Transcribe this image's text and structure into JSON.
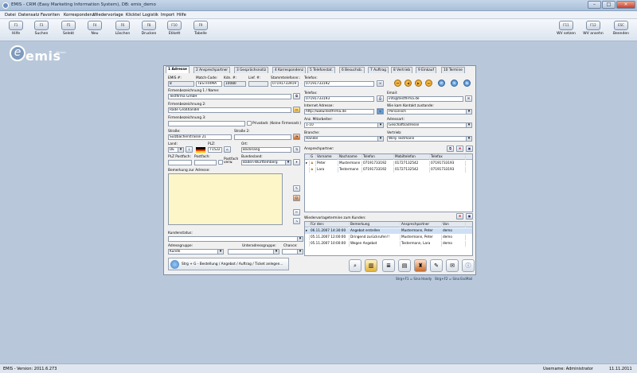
{
  "window": {
    "title": "EMIS - CRM (Easy Marketing Information System), DB: emis_demo",
    "controls": [
      "–",
      "□",
      "×"
    ]
  },
  "menu": [
    "Datei",
    "Datensatz",
    "Favoriten",
    "Korrespondenz",
    "Wiedervorlage",
    "Klicktel",
    "Logistik",
    "Import",
    "Hilfe"
  ],
  "toolbar": {
    "left": [
      {
        "key": "F1",
        "label": "Hilfe"
      },
      {
        "key": "F3",
        "label": "Suchen"
      },
      {
        "key": "F5",
        "label": "Selekt"
      },
      {
        "key": "F4",
        "label": "Neu"
      },
      {
        "key": "F6",
        "label": "Löschen"
      },
      {
        "key": "F8",
        "label": "Drucken"
      },
      {
        "key": "F10",
        "label": "Etikett"
      },
      {
        "key": "F9",
        "label": "Tabelle"
      }
    ],
    "right": [
      {
        "key": "F11",
        "label": "WV setzen"
      },
      {
        "key": "F12",
        "label": "WV ansehn"
      },
      {
        "key": "ESC",
        "label": "Beenden"
      }
    ]
  },
  "logo": {
    "text": "emis",
    "small": "Version"
  },
  "tabs": [
    {
      "label": "1 Adresse",
      "active": true
    },
    {
      "label": "2 Ansprechpartner"
    },
    {
      "label": "3 Gesprächsnotiz"
    },
    {
      "label": "4 Korrespondenz"
    },
    {
      "label": "5 Telefonstat."
    },
    {
      "label": "6 Besuchsb."
    },
    {
      "label": "7 Auftrag"
    },
    {
      "label": "8 Vertrieb"
    },
    {
      "label": "9 Einkauf"
    },
    {
      "label": "10 Termine"
    }
  ],
  "form": {
    "emis_nr_label": "EMIS #:",
    "emis_nr": "8",
    "match_label": "Match-Code:",
    "match": "TESTFIRMA",
    "kdnr_label": "Kdn. #:",
    "kdnr": "10080",
    "lief_label": "Lief. #:",
    "lief": "",
    "stamm_label": "Stammtelefonnr.:",
    "stamm": "07191733919",
    "firma1_label": "Firmenbezeichnung 1 / Name:",
    "firma1": "Testfirma GmbH",
    "firma2_label": "Firmenbezeichnung 2:",
    "firma2": "Rade Großhandel",
    "firma3_label": "Firmenbezeichnung 3:",
    "firma3": "",
    "privat_label": "Privatadr. (Keine Firmenadr.)",
    "strasse_label": "Straße:",
    "strasse": "Sulzbacherstrasse 21",
    "strasse2_label": "Straße 2:",
    "strasse2": "",
    "land_label": "Land:",
    "land": "DE",
    "plz_label": "PLZ:",
    "plz": "71522",
    "ort_label": "Ort:",
    "ort": "Backnang",
    "plzpost_label": "PLZ Postfach:",
    "postfach_label": "Postfach:",
    "postfachverw_label": "Postfach verw.",
    "bundesland_label": "Bundesland:",
    "bundesland": "Baden-Württemberg",
    "bemerkung_label": "Bemerkung zur Adresse:",
    "kundenstatus_label": "Kundenstatus:",
    "kundenstatus": "",
    "adressgruppe_label": "Adressgruppe:",
    "adressgruppe": "Kunde",
    "unteradress_label": "Unteradressgruppe:",
    "unteradress": "",
    "chance_label": "Chance:",
    "chance": "",
    "bestell_hint": "Strg + G - Bestellung / Angebot / Auftrag / Ticket anlegen...",
    "telefon_label": "Telefon:",
    "telefon": "07191733192",
    "telefax_label": "Telefax:",
    "telefax": "07191733193",
    "email_label": "Email:",
    "email": "info@testfirma.de",
    "internet_label": "Internet Adresse:",
    "internet": "http://www.testfirma.de",
    "kontakt_label": "Wie kam Kontakt zustande:",
    "kontakt": "Persönlich",
    "mitarbeiter_label": "Anz. Mitarbeiter:",
    "mitarbeiter": "1-10",
    "adressart_label": "Adressart:",
    "adressart": "Geschäftsadresse",
    "branche_label": "Branche:",
    "branche": "Handel",
    "vertrieb_label": "Vertrieb:",
    "vertrieb": "Willy Testmann"
  },
  "ansprech": {
    "title": "Ansprechpartner:",
    "headers": [
      "G",
      "Vorname",
      "Nachname",
      "Telefon",
      "Mobiltelefon",
      "Telefax"
    ],
    "rows": [
      [
        "",
        "Peter",
        "Mustermann",
        "07191733192",
        "01727132542",
        "07191733193"
      ],
      [
        "",
        "Lara",
        "Testermann",
        "07191733192",
        "01727132542",
        "07191733193"
      ]
    ]
  },
  "wv": {
    "title": "Wiedervorlagetermine zum Kunden:",
    "headers": [
      "Für den:",
      "Bemerkung",
      "Ansprechpartner",
      "Von"
    ],
    "rows": [
      [
        "06.11.2007 14:30:00",
        "Angebot erstellen",
        "Mustermann, Peter",
        "demo"
      ],
      [
        "05.11.2007 12:00:00",
        "Dringend zurückrufen!!",
        "Mustermann, Peter",
        "demo"
      ],
      [
        "05.11.2007 10:00:00",
        "Wegen Angebot",
        "Testermann, Lara",
        "demo"
      ]
    ]
  },
  "hints": {
    "h1": "Strg+F1 = Sina Handy",
    "h2": "Strg+F2 = Sina EscMail"
  },
  "status": {
    "version": "EMIS - Version: 2011.6.273",
    "user": "Username: Administrator",
    "date": "11.11.2011"
  }
}
